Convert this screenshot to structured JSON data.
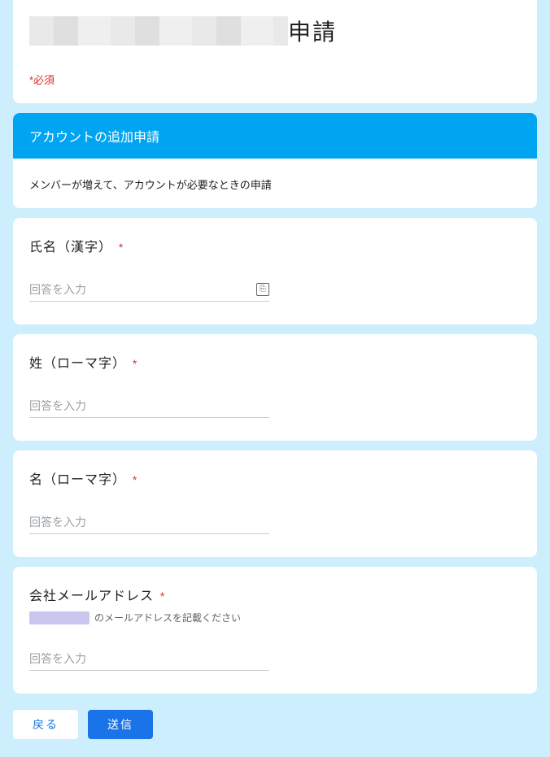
{
  "header": {
    "title_suffix": "申請",
    "required_note": "*必須"
  },
  "section": {
    "title": "アカウントの追加申請",
    "desc": "メンバーが増えて、アカウントが必要なときの申請"
  },
  "questions": [
    {
      "label": "氏名（漢字）",
      "required": "*",
      "placeholder": "回答を入力",
      "has_autofill": true
    },
    {
      "label": "姓（ローマ字）",
      "required": "*",
      "placeholder": "回答を入力"
    },
    {
      "label": "名（ローマ字）",
      "required": "*",
      "placeholder": "回答を入力"
    },
    {
      "label": "会社メールアドレス",
      "required": "*",
      "desc_suffix": "のメールアドレスを記載ください",
      "placeholder": "回答を入力"
    }
  ],
  "buttons": {
    "back": "戻る",
    "submit": "送信"
  }
}
